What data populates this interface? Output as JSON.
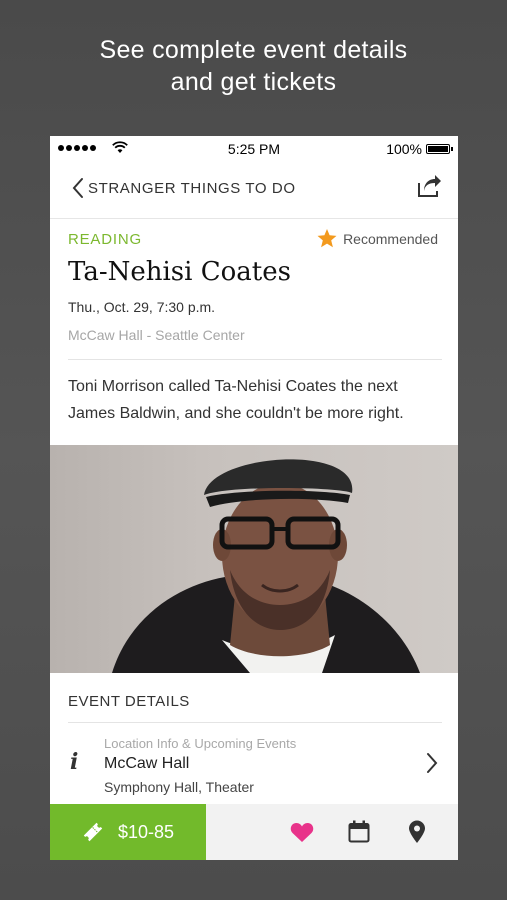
{
  "promo": {
    "line1": "See complete event details",
    "line2": "and get tickets"
  },
  "status_bar": {
    "time": "5:25 PM",
    "battery": "100%"
  },
  "nav": {
    "back_label": "STRANGER THINGS TO DO"
  },
  "event": {
    "category": "READING",
    "recommended_label": "Recommended",
    "title": "Ta-Nehisi Coates",
    "date": "Thu., Oct. 29, 7:30 p.m.",
    "venue": "McCaw Hall -  Seattle Center",
    "description": "Toni Morrison called Ta-Nehisi Coates the next James Baldwin, and she couldn't be more right."
  },
  "details": {
    "heading": "EVENT DETAILS",
    "location_sub": "Location Info & Upcoming Events",
    "location_name": "McCaw Hall",
    "location_types": "Symphony Hall, Theater"
  },
  "footer": {
    "price": "$10-85"
  },
  "colors": {
    "accent_green": "#72ba2b",
    "category_green": "#7cb82f",
    "star_orange": "#f39a1e",
    "heart_pink": "#e8338a"
  },
  "icons": [
    "share-icon",
    "star-icon",
    "info-icon",
    "chevron-right-icon",
    "ticket-icon",
    "heart-icon",
    "calendar-icon",
    "location-pin-icon"
  ]
}
